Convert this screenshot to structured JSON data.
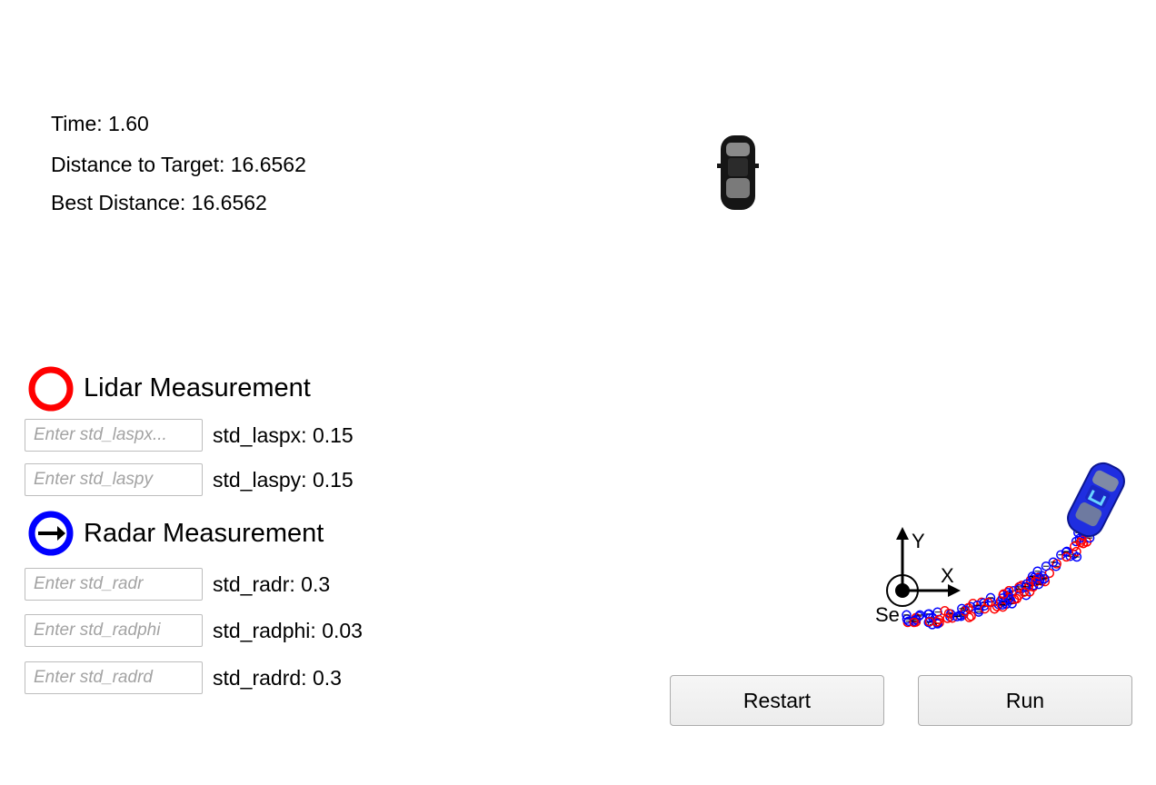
{
  "status": {
    "time": "Time: 1.60",
    "distance_to_target": "Distance to Target: 16.6562",
    "best_distance": "Best Distance: 16.6562"
  },
  "lidar": {
    "title": "Lidar Measurement",
    "icon": "red-ring-icon",
    "color": "#ff0000",
    "fields": [
      {
        "placeholder": "Enter std_laspx...",
        "label": "std_laspx: 0.15"
      },
      {
        "placeholder": "Enter std_laspy",
        "label": "std_laspy: 0.15"
      }
    ]
  },
  "radar": {
    "title": "Radar Measurement",
    "icon": "blue-ring-arrow-icon",
    "color": "#0000ff",
    "fields": [
      {
        "placeholder": "Enter std_radr",
        "label": "std_radr: 0.3"
      },
      {
        "placeholder": "Enter std_radphi",
        "label": "std_radphi: 0.03"
      },
      {
        "placeholder": "Enter std_radrd",
        "label": "std_radrd: 0.3"
      }
    ]
  },
  "scene": {
    "target_car": "black-car-icon",
    "tracked_car": "blue-car-icon",
    "axis_x_label": "X",
    "axis_y_label": "Y",
    "sensor_label": "Se"
  },
  "buttons": {
    "restart": "Restart",
    "run": "Run"
  }
}
